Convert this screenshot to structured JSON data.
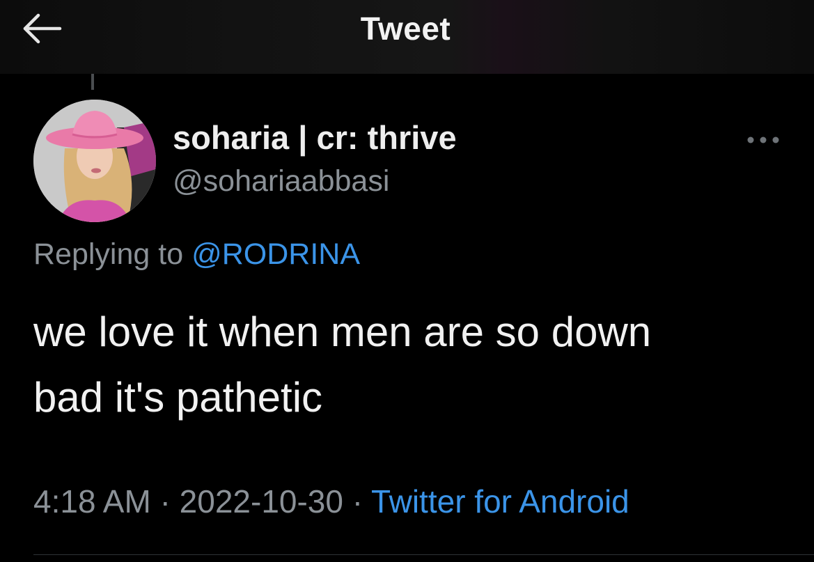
{
  "header": {
    "title": "Tweet",
    "back_icon": "arrow-left-icon"
  },
  "author": {
    "display_name": "soharia | cr: thrive",
    "handle": "@sohariaabbasi",
    "avatar_icon": "profile-avatar"
  },
  "more_icon": "more-options-icon",
  "reply": {
    "prefix": "Replying to",
    "mention": "@RODRINA"
  },
  "tweet": {
    "text": "we love it when men are so down\nbad it's pathetic"
  },
  "meta": {
    "time": "4:18 AM",
    "separator": "·",
    "date": "2022-10-30",
    "source": "Twitter for Android"
  },
  "colors": {
    "background": "#000000",
    "text": "#f1f1f1",
    "secondary_text": "#8b9197",
    "link": "#3b94e8"
  }
}
